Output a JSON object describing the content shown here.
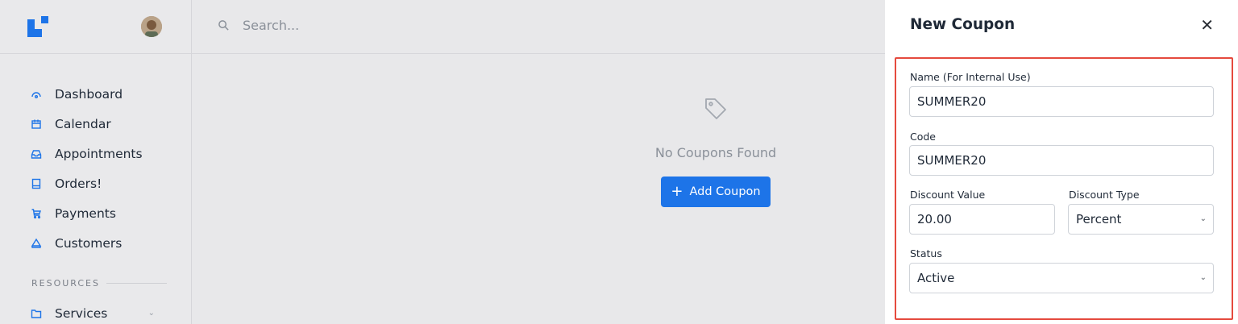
{
  "search": {
    "placeholder": "Search..."
  },
  "sidebar": {
    "items": [
      {
        "label": "Dashboard",
        "icon": "gauge-icon"
      },
      {
        "label": "Calendar",
        "icon": "calendar-icon"
      },
      {
        "label": "Appointments",
        "icon": "inbox-icon"
      },
      {
        "label": "Orders!",
        "icon": "tablet-icon"
      },
      {
        "label": "Payments",
        "icon": "cart-icon"
      },
      {
        "label": "Customers",
        "icon": "user-icon"
      }
    ],
    "resources_label": "RESOURCES",
    "services": {
      "label": "Services",
      "icon": "folder-icon"
    }
  },
  "empty_state": {
    "message": "No Coupons Found",
    "add_button": "Add Coupon",
    "icon": "tag-icon"
  },
  "panel": {
    "title": "New Coupon",
    "fields": {
      "name": {
        "label": "Name (For Internal Use)",
        "value": "SUMMER20"
      },
      "code": {
        "label": "Code",
        "value": "SUMMER20"
      },
      "discount_value": {
        "label": "Discount Value",
        "value": "20.00"
      },
      "discount_type": {
        "label": "Discount Type",
        "value": "Percent"
      },
      "status": {
        "label": "Status",
        "value": "Active"
      }
    }
  },
  "colors": {
    "accent": "#1d74e8",
    "highlight_border": "#e54a3e"
  }
}
